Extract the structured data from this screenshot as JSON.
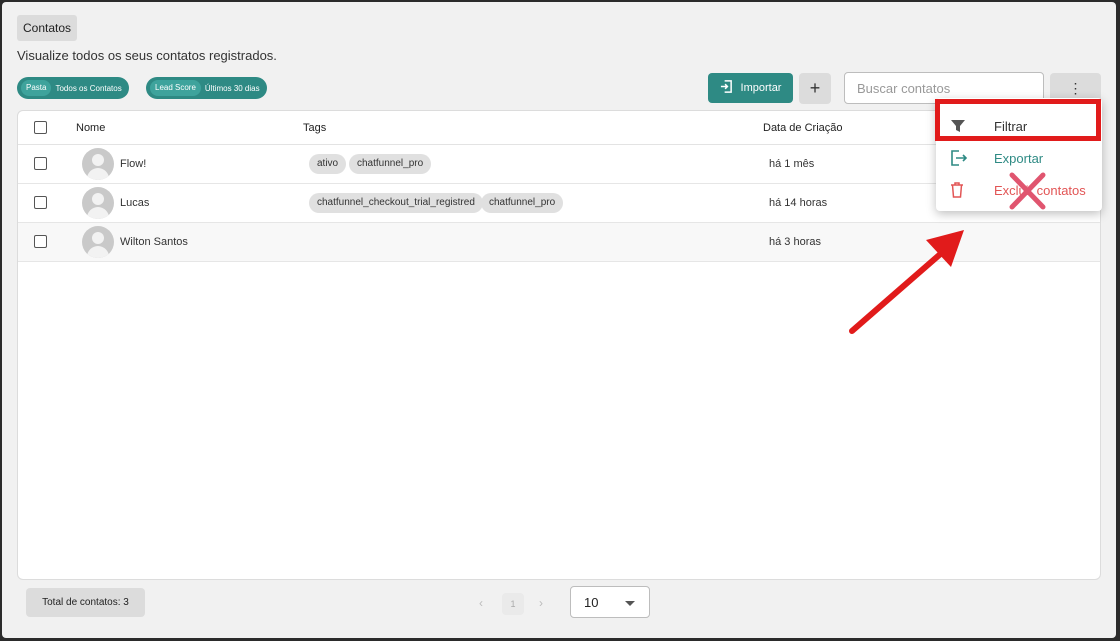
{
  "page": {
    "breadcrumb": "Contatos",
    "subtitle": "Visualize todos os seus contatos registrados."
  },
  "filters": [
    {
      "key": "Pasta",
      "value": "Todos os Contatos"
    },
    {
      "key": "Lead Score",
      "value": "Últimos 30 dias"
    }
  ],
  "toolbar": {
    "import_label": "Importar",
    "add_label": "+",
    "search_placeholder": "Buscar contatos",
    "more_label": "⋮"
  },
  "table": {
    "columns": [
      "Nome",
      "Tags",
      "Data de Criação"
    ],
    "rows": [
      {
        "name": "Flow!",
        "tags": [
          "ativo",
          "chatfunnel_pro"
        ],
        "created": "há 1 mês"
      },
      {
        "name": "Lucas",
        "tags": [
          "chatfunnel_checkout_trial_registred",
          "chatfunnel_pro"
        ],
        "created": "há 14 horas"
      },
      {
        "name": "Wilton Santos",
        "tags": [],
        "created": "há 3 horas"
      }
    ]
  },
  "menu": {
    "items": [
      {
        "label": "Filtrar",
        "color": "#333333",
        "icon": "filter-icon"
      },
      {
        "label": "Exportar",
        "color": "#2e8a84",
        "icon": "export-icon"
      },
      {
        "label": "Excluir contatos",
        "color": "#e25555",
        "icon": "trash-icon"
      }
    ]
  },
  "footer": {
    "total_label": "Total de contatos: 3",
    "page": "1",
    "prev": "‹",
    "next": "›",
    "page_size": "10"
  },
  "colors": {
    "accent": "#2e8a84",
    "annotation_red": "#e11b1b"
  }
}
